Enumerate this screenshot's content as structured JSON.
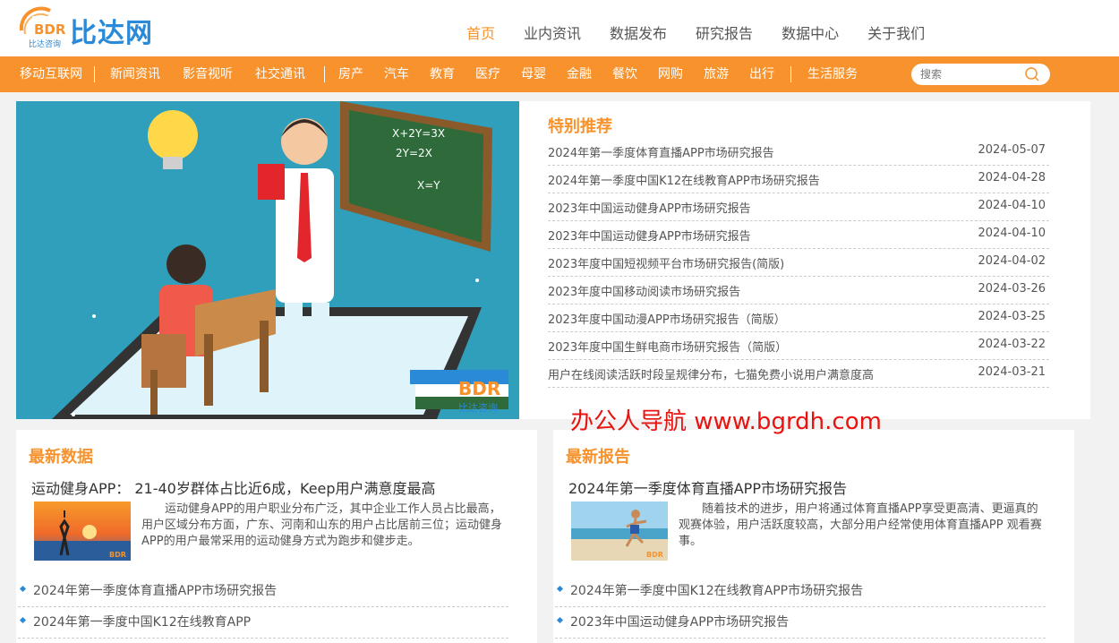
{
  "brand": {
    "name": "比达网",
    "logo_mark": "BDR",
    "logo_sub": "比达咨询"
  },
  "topnav": [
    "首页",
    "业内资讯",
    "数据发布",
    "研究报告",
    "数据中心",
    "关于我们"
  ],
  "categories": [
    "移动互联网",
    "新闻资讯",
    "影音视听",
    "社交通讯",
    "房产",
    "汽车",
    "教育",
    "医疗",
    "母婴",
    "金融",
    "餐饮",
    "网购",
    "旅游",
    "出行",
    "生活服务"
  ],
  "search": {
    "placeholder": "搜索"
  },
  "hero": {
    "watermark": "BDR",
    "watermark_sub": "比达咨询",
    "board_lines": [
      "X+2Y=3X",
      "2Y=2X",
      "X=Y"
    ]
  },
  "recommend": {
    "title": "特别推荐",
    "items": [
      {
        "title": "2024年第一季度体育直播APP市场研究报告",
        "date": "2024-05-07"
      },
      {
        "title": "2024年第一季度中国K12在线教育APP市场研究报告",
        "date": "2024-04-28"
      },
      {
        "title": "2023年中国运动健身APP市场研究报告",
        "date": "2024-04-10"
      },
      {
        "title": "2023年中国运动健身APP市场研究报告",
        "date": "2024-04-10"
      },
      {
        "title": "2023年度中国短视频平台市场研究报告(简版)",
        "date": "2024-04-02"
      },
      {
        "title": "2023年度中国移动阅读市场研究报告",
        "date": "2024-03-26"
      },
      {
        "title": "2023年度中国动漫APP市场研究报告（简版）",
        "date": "2024-03-25"
      },
      {
        "title": "2023年度中国生鲜电商市场研究报告（简版）",
        "date": "2024-03-22"
      },
      {
        "title": "用户在线阅读活跃时段呈规律分布，七猫免费小说用户满意度高",
        "date": "2024-03-21"
      }
    ]
  },
  "overlay_text": "办公人导航 www.bgrdh.com",
  "latest_data": {
    "title": "最新数据",
    "headline": "运动健身APP： 21-40岁群体占比近6成，Keep用户满意度最高",
    "desc": "运动健身APP的用户职业分布广泛，其中企业工作人员占比最高，用户区域分布方面，广东、河南和山东的用户占比居前三位；运动健身APP的用户最常采用的运动健身方式为跑步和健步走。",
    "list": [
      "2024年第一季度体育直播APP市场研究报告",
      "2024年第一季度中国K12在线教育APP"
    ]
  },
  "latest_report": {
    "title": "最新报告",
    "headline": "2024年第一季度体育直播APP市场研究报告",
    "desc": "随着技术的进步，用户将通过体育直播APP享受更高清、更逼真的观赛体验，用户活跃度较高，大部分用户经常使用体育直播APP 观看赛事。",
    "list": [
      "2024年第一季度中国K12在线教育APP市场研究报告",
      "2023年中国运动健身APP市场研究报告"
    ]
  },
  "colors": {
    "accent": "#f7922c",
    "brand_blue": "#2a8ad8",
    "overlay_red": "#e8130f",
    "page_bg": "#f2f2f2"
  },
  "icons": [
    "logo-mark",
    "search-icon",
    "diamond-bullet-icon"
  ]
}
